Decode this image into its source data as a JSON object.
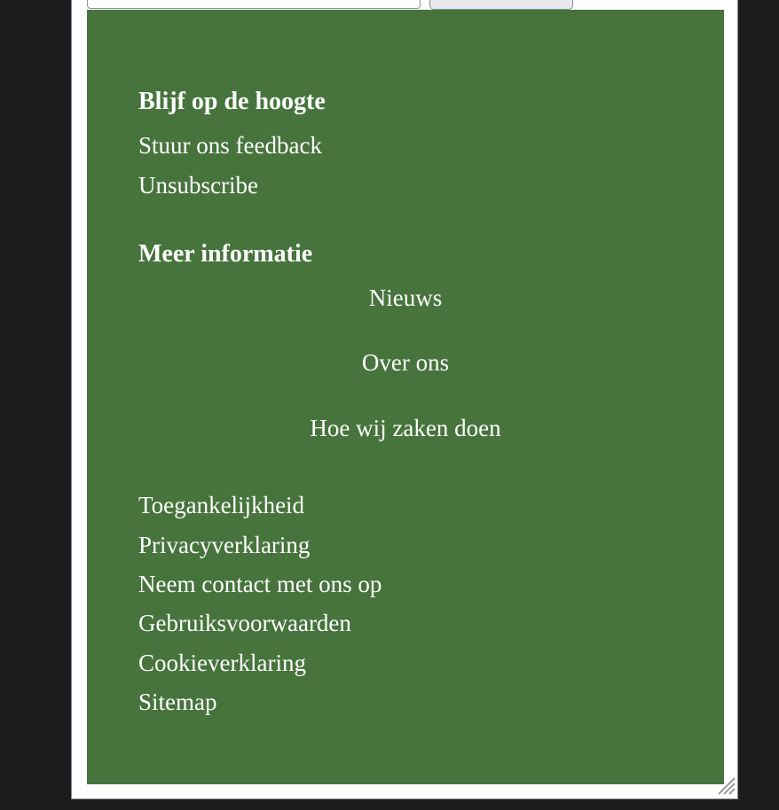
{
  "footer": {
    "stay_updated": {
      "heading": "Blijf op de hoogte",
      "links": [
        "Stuur ons feedback",
        "Unsubscribe"
      ]
    },
    "more_info": {
      "heading": "Meer informatie",
      "center_links": [
        "Nieuws",
        "Over ons",
        "Hoe wij zaken doen"
      ]
    },
    "legal_links": [
      "Toegankelijkheid",
      "Privacyverklaring",
      "Neem contact met ons op",
      "Gebruiksvoorwaarden",
      "Cookieverklaring",
      "Sitemap"
    ]
  },
  "colors": {
    "footer_bg": "#46743c",
    "page_bg": "#1c1c1e"
  }
}
